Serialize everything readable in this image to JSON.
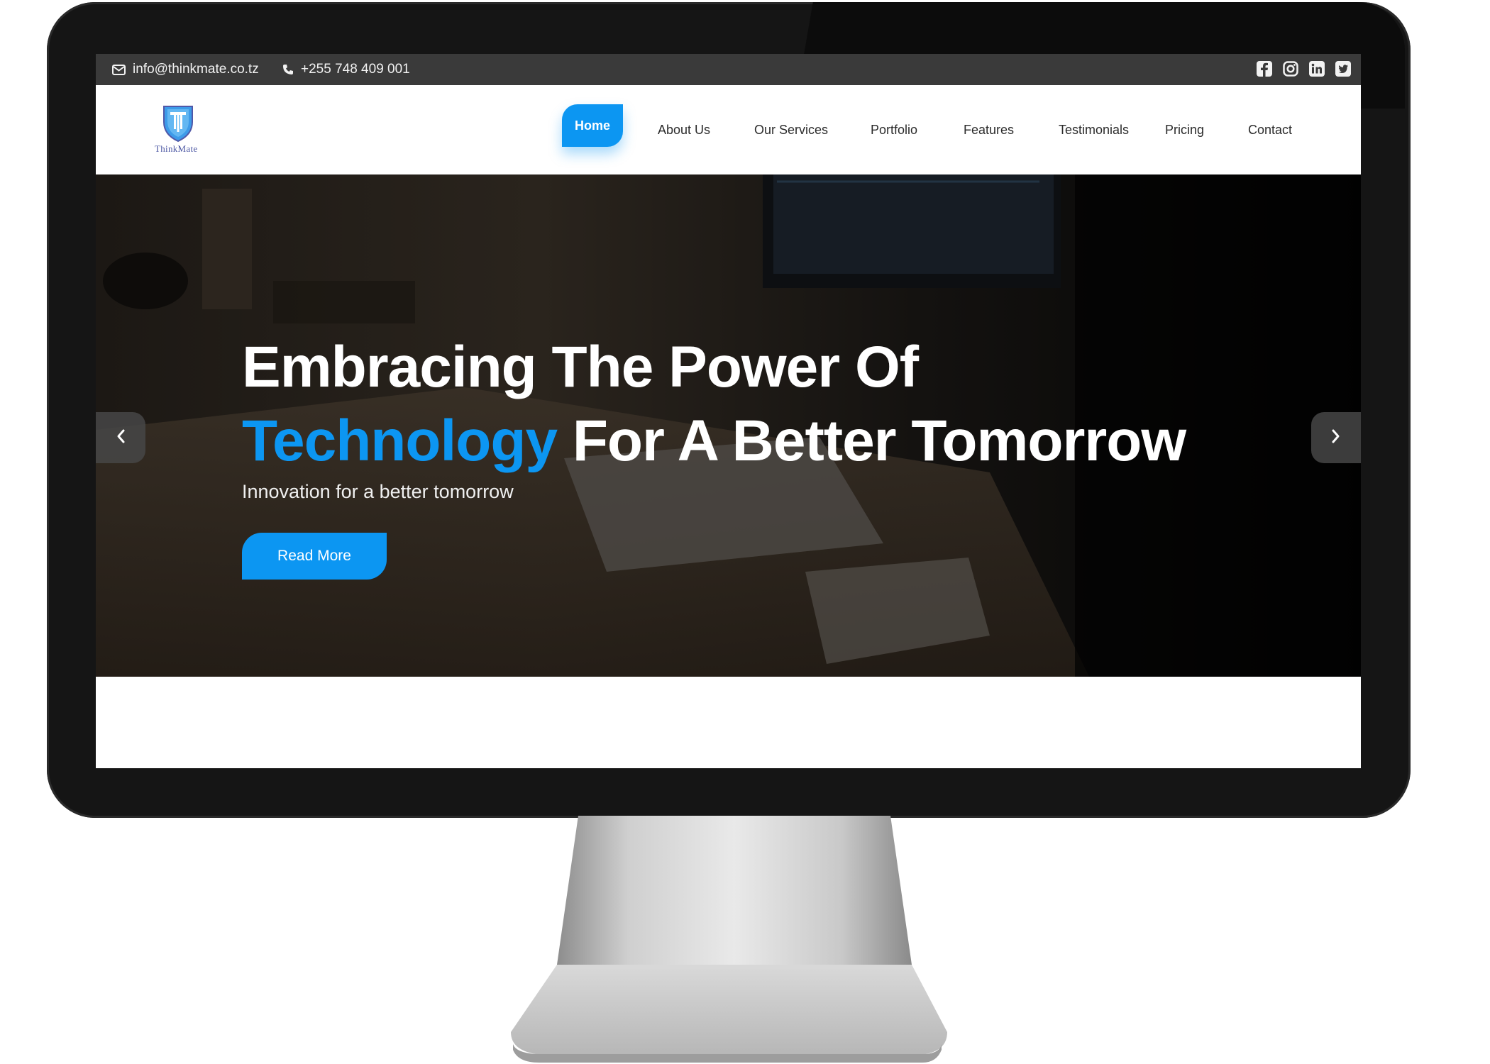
{
  "topbar": {
    "email": "info@thinkmate.co.tz",
    "phone": "+255 748 409 001",
    "social_icons": [
      "facebook-icon",
      "instagram-icon",
      "linkedin-icon",
      "twitter-icon"
    ]
  },
  "brand": {
    "logo_text": "ThinkMate"
  },
  "nav": {
    "home": "Home",
    "about": "About Us",
    "services": "Our Services",
    "portfolio": "Portfolio",
    "features": "Features",
    "testimonials": "Testimonials",
    "pricing": "Pricing",
    "contact": "Contact"
  },
  "hero": {
    "title_line1": "Embracing The Power Of",
    "title_accent": "Technology",
    "title_rest": "For A Better Tomorrow",
    "subtitle": "Innovation for a better tomorrow",
    "button": "Read More"
  },
  "colors": {
    "accent": "#0c96f2",
    "topbar": "#3a3a3a",
    "monitor": "#151515"
  }
}
